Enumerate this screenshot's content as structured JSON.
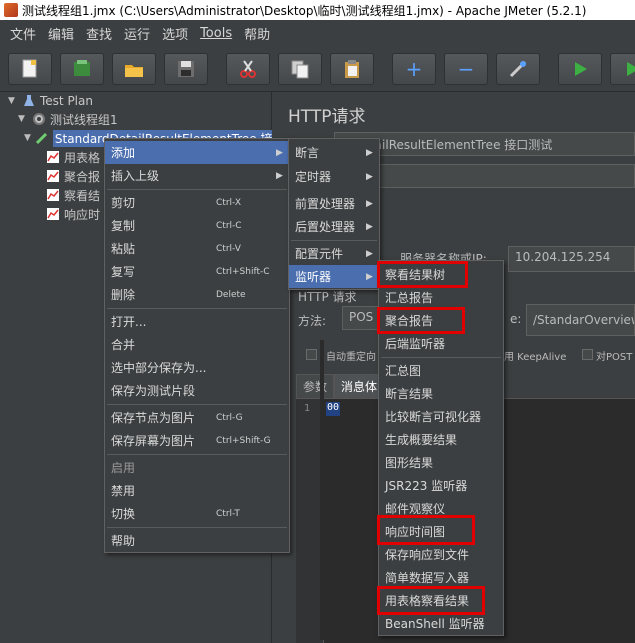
{
  "window": {
    "title": "测试线程组1.jmx (C:\\Users\\Administrator\\Desktop\\临时\\测试线程组1.jmx) - Apache JMeter (5.2.1)"
  },
  "menubar": [
    "文件",
    "编辑",
    "查找",
    "运行",
    "选项",
    "Tools",
    "帮助"
  ],
  "toolbar": {
    "icons": [
      "new-icon",
      "templates-icon",
      "open-icon",
      "save-icon",
      "cut-icon",
      "copy-icon",
      "paste-icon",
      "expand-icon",
      "collapse-icon",
      "toggle-icon",
      "start-icon",
      "start-no-pause-icon"
    ],
    "plus": "+",
    "minus": "−"
  },
  "tree": {
    "test_plan": "Test Plan",
    "thread_group": "测试线程组1",
    "sampler": "StandardDetailResultElementTree 接口",
    "child1": "用表格",
    "child2": "聚合报",
    "child3": "察看结",
    "child4": "响应时"
  },
  "panel": {
    "title": "HTTP请求",
    "name_value": "rdDetailResultElementTree 接口测试",
    "server_label": "服务器名称或IP:",
    "server_value": "10.204.125.254",
    "http_label": "HTTP 请求",
    "method_label": "方法:",
    "method_value": "POS",
    "path_label": "e:",
    "path_value": "/StandarOverviewC",
    "auto_redirect": "自动重定向",
    "keepalive": "用 KeepAlive",
    "post_label": "对POST",
    "tab_params": "参数",
    "tab_body": "消息体",
    "line_number": "1",
    "caret_text": "00"
  },
  "context_menu": {
    "add": "添加",
    "insert_parent": "插入上级",
    "cut": "剪切",
    "cut_sc": "Ctrl-X",
    "copy": "复制",
    "copy_sc": "Ctrl-C",
    "paste": "粘贴",
    "paste_sc": "Ctrl-V",
    "duplicate": "复写",
    "duplicate_sc": "Ctrl+Shift-C",
    "remove": "删除",
    "remove_sc": "Delete",
    "open": "打开...",
    "merge": "合并",
    "save_selection": "选中部分保存为...",
    "save_fragment": "保存为测试片段",
    "save_node_image": "保存节点为图片",
    "save_node_image_sc": "Ctrl-G",
    "save_screen_image": "保存屏幕为图片",
    "save_screen_image_sc": "Ctrl+Shift-G",
    "enable": "启用",
    "disable": "禁用",
    "toggle": "切换",
    "toggle_sc": "Ctrl-T",
    "help": "帮助"
  },
  "add_menu": {
    "assertions": "断言",
    "timers": "定时器",
    "pre_processors": "前置处理器",
    "post_processors": "后置处理器",
    "config_elements": "配置元件",
    "listeners": "监听器"
  },
  "listener_menu": {
    "view_results_tree": "察看结果树",
    "summary_report": "汇总报告",
    "aggregate_report": "聚合报告",
    "backend_listener": "后端监听器",
    "aggregate_graph": "汇总图",
    "assertion_results": "断言结果",
    "comparison_assertion_visualizer": "比较断言可视化器",
    "generate_summary_results": "生成概要结果",
    "graph_results": "图形结果",
    "jsr223_listener": "JSR223 监听器",
    "mailer_visualizer": "邮件观察仪",
    "response_time_graph": "响应时间图",
    "save_responses_to_file": "保存响应到文件",
    "simple_data_writer": "简单数据写入器",
    "view_results_in_table": "用表格察看结果",
    "beanshell_listener": "BeanShell 监听器"
  },
  "colors": {
    "highlight_box": "#e10000",
    "selection": "#4b6eaf",
    "background": "#3c3f41"
  }
}
